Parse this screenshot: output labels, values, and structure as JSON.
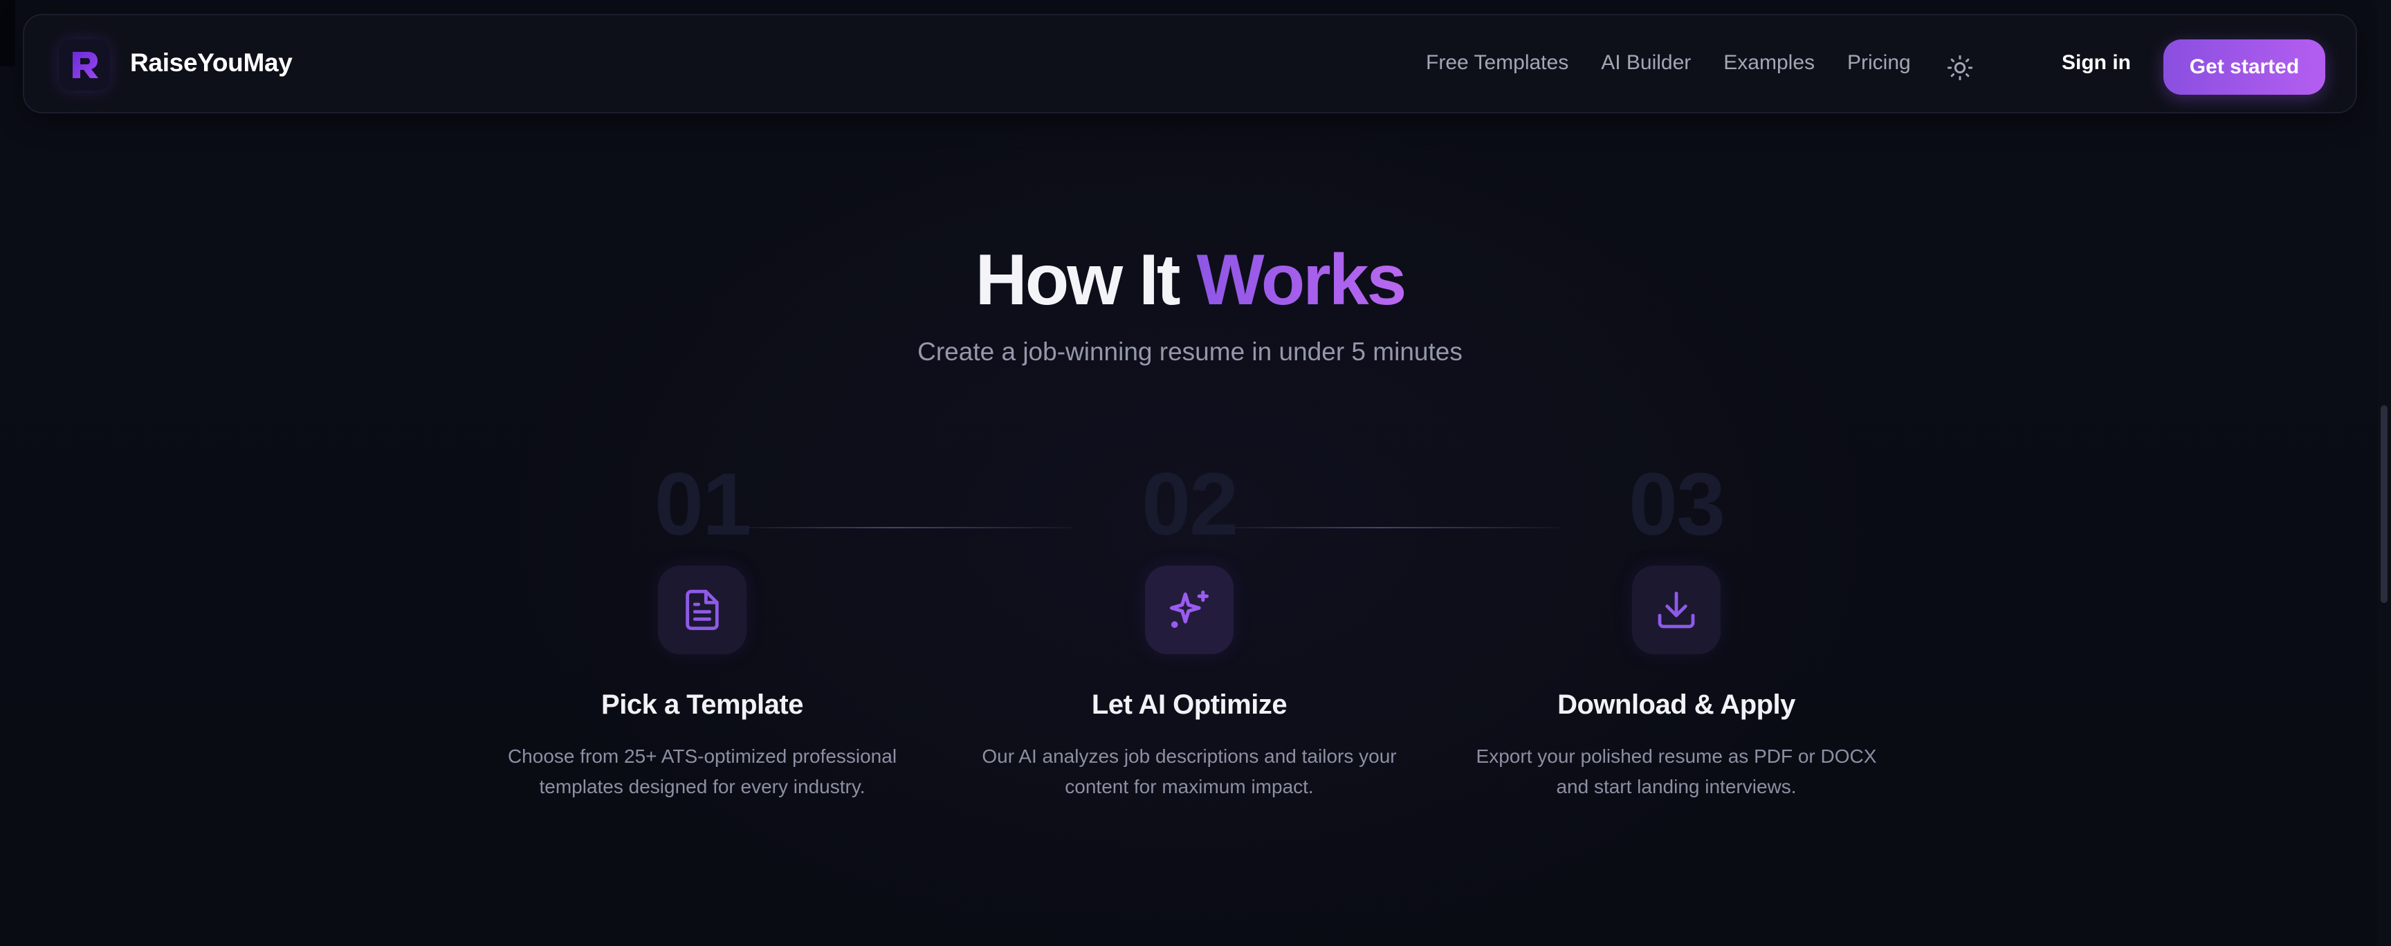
{
  "nav": {
    "brand": "RaiseYouMay",
    "links": [
      "Free Templates",
      "AI Builder",
      "Examples",
      "Pricing"
    ],
    "theme_icon": "sun-icon",
    "sign_in": "Sign in",
    "cta": "Get started"
  },
  "section": {
    "title_plain": "How It ",
    "title_accent": "Works",
    "subtitle": "Create a job-winning resume in under 5 minutes"
  },
  "steps": [
    {
      "number": "01",
      "icon": "document-icon",
      "title": "Pick a Template",
      "desc_line1": "Choose from 25+ ATS-optimized professional",
      "desc_line2": "templates designed for every industry."
    },
    {
      "number": "02",
      "icon": "sparkles-icon",
      "title": "Let AI Optimize",
      "desc_line1": "Our AI analyzes job descriptions and tailors your",
      "desc_line2": "content for maximum impact."
    },
    {
      "number": "03",
      "icon": "download-icon",
      "title": "Download & Apply",
      "desc_line1": "Export your polished resume as PDF or DOCX",
      "desc_line2": "and start landing interviews."
    }
  ],
  "colors": {
    "background": "#0a0c14",
    "accent_start": "#8f56e6",
    "accent_end": "#b968f0",
    "muted_text": "#8d90a3"
  }
}
